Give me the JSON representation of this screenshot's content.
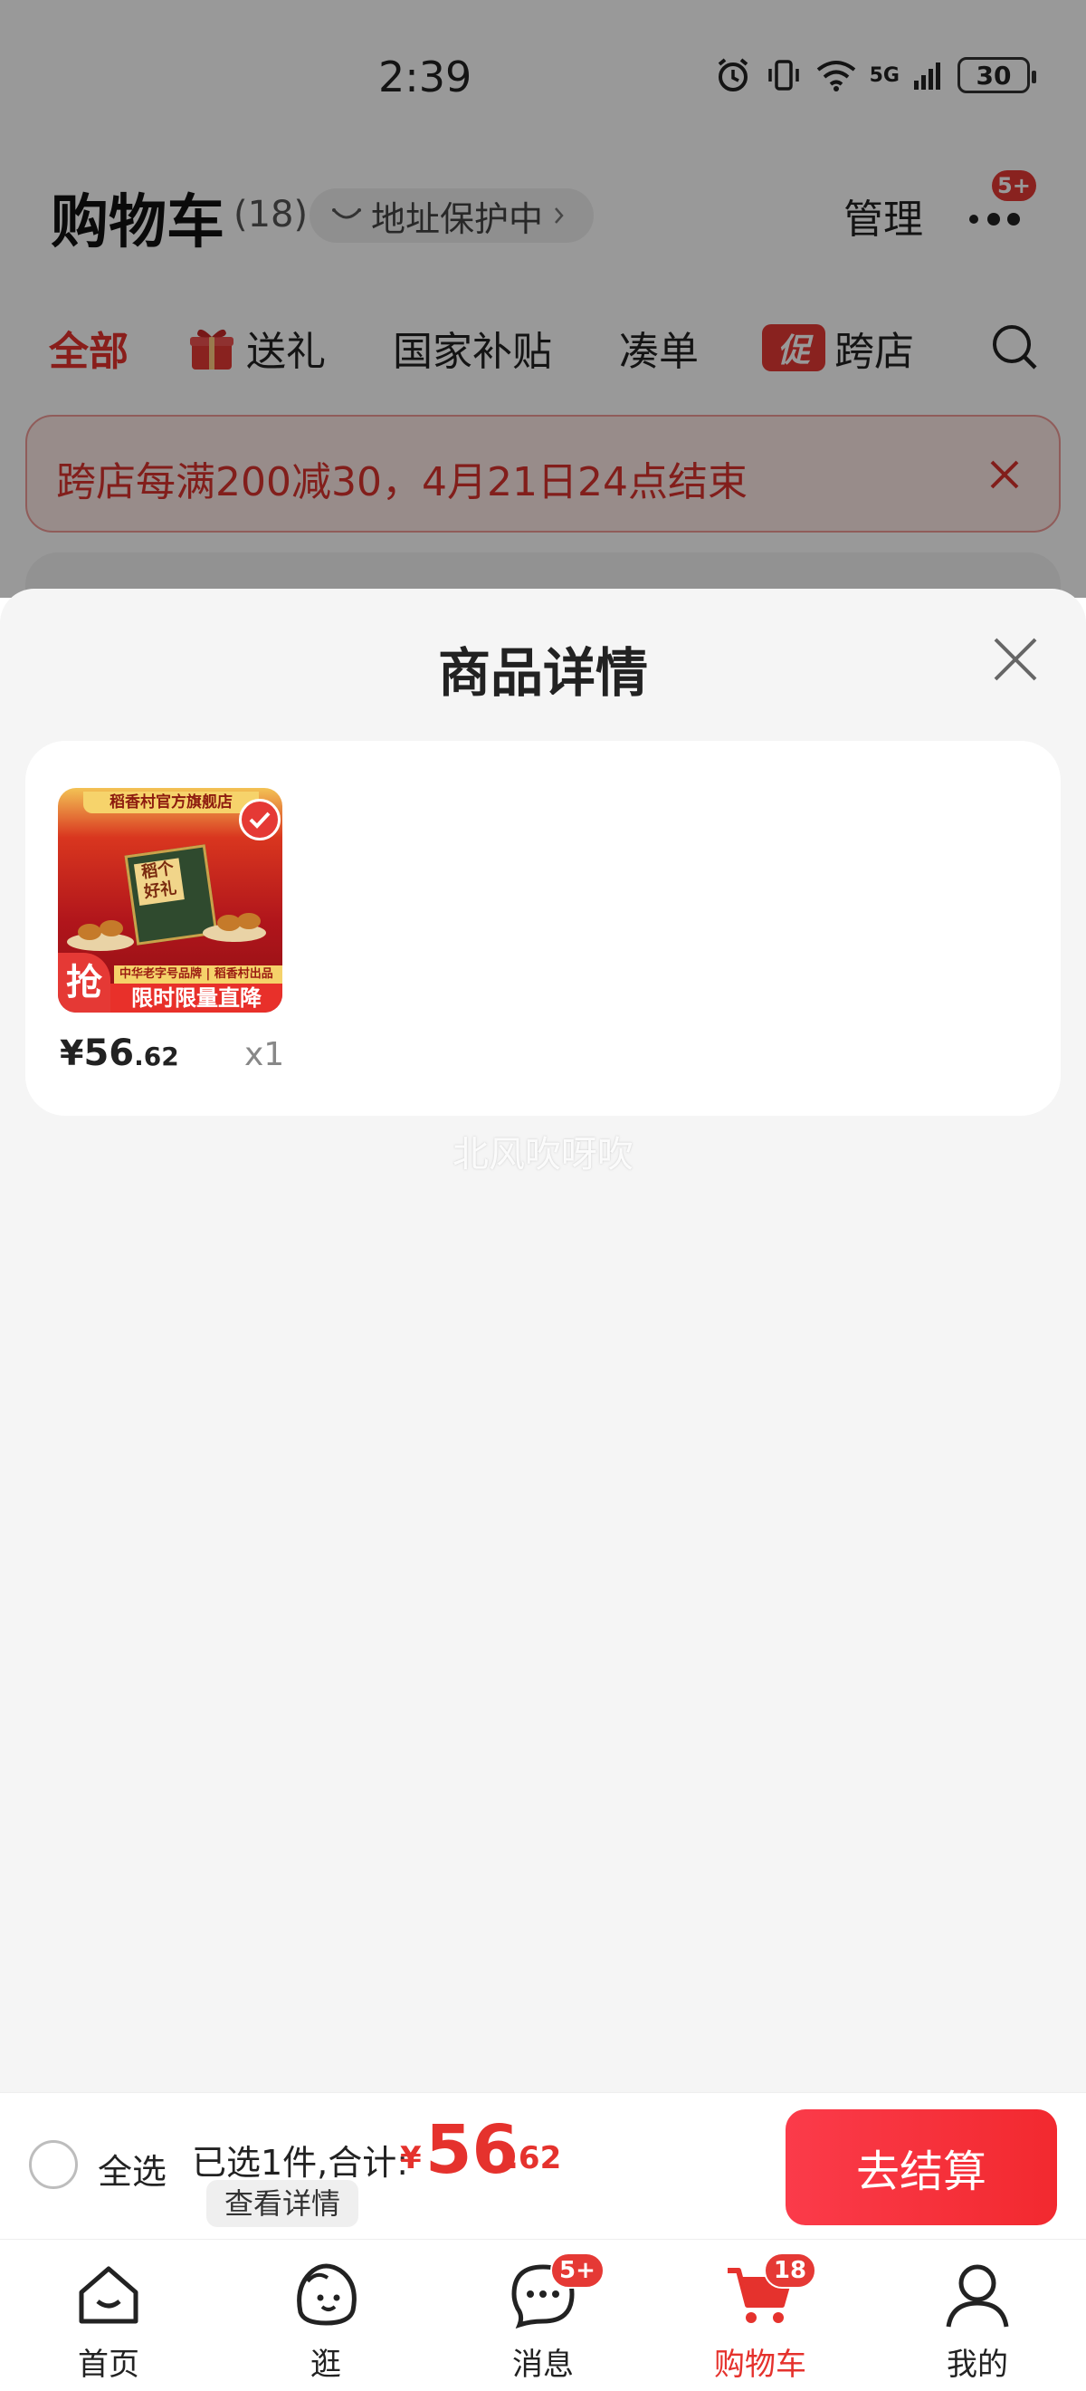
{
  "status_bar": {
    "time": "2:39",
    "network": "5G",
    "battery": "30"
  },
  "header": {
    "title": "购物车",
    "count": "(18)",
    "address_label": "地址保护中",
    "manage_label": "管理",
    "more_badge": "5+"
  },
  "tabs": [
    {
      "label": "全部"
    },
    {
      "label": "送礼"
    },
    {
      "label": "国家补贴"
    },
    {
      "label": "凑单"
    },
    {
      "label": "跨店",
      "chip": "促"
    }
  ],
  "promo": {
    "text": "跨店每满200减30，4月21日24点结束"
  },
  "sheet": {
    "title": "商品详情",
    "item": {
      "price_symbol": "¥",
      "price_int": "56",
      "price_dec": ".62",
      "quantity": "x1",
      "image": {
        "shop_band": "稻香村官方旗舰店",
        "box_label": "稻个好礼",
        "grab_badge": "抢",
        "brand_strip": "中华老字号品牌 | 稻香村出品",
        "promo_strip": "限时限量直降"
      }
    },
    "watermark": "北风吹呀吹"
  },
  "checkout": {
    "select_all": "全选",
    "summary": "已选1件,合计:",
    "total_symbol": "¥",
    "total_int": "56",
    "total_dec": ".62",
    "view_detail": "查看详情",
    "checkout_button": "去结算"
  },
  "bottom_nav": [
    {
      "label": "首页",
      "icon": "home-icon"
    },
    {
      "label": "逛",
      "icon": "stroll-icon"
    },
    {
      "label": "消息",
      "icon": "message-icon",
      "badge": "5+"
    },
    {
      "label": "购物车",
      "icon": "cart-icon",
      "badge": "18",
      "active": true
    },
    {
      "label": "我的",
      "icon": "profile-icon"
    }
  ],
  "colors": {
    "accent": "#e5322d",
    "sheet_bg": "#f5f5f5",
    "checkout_button": "#f2292f"
  }
}
